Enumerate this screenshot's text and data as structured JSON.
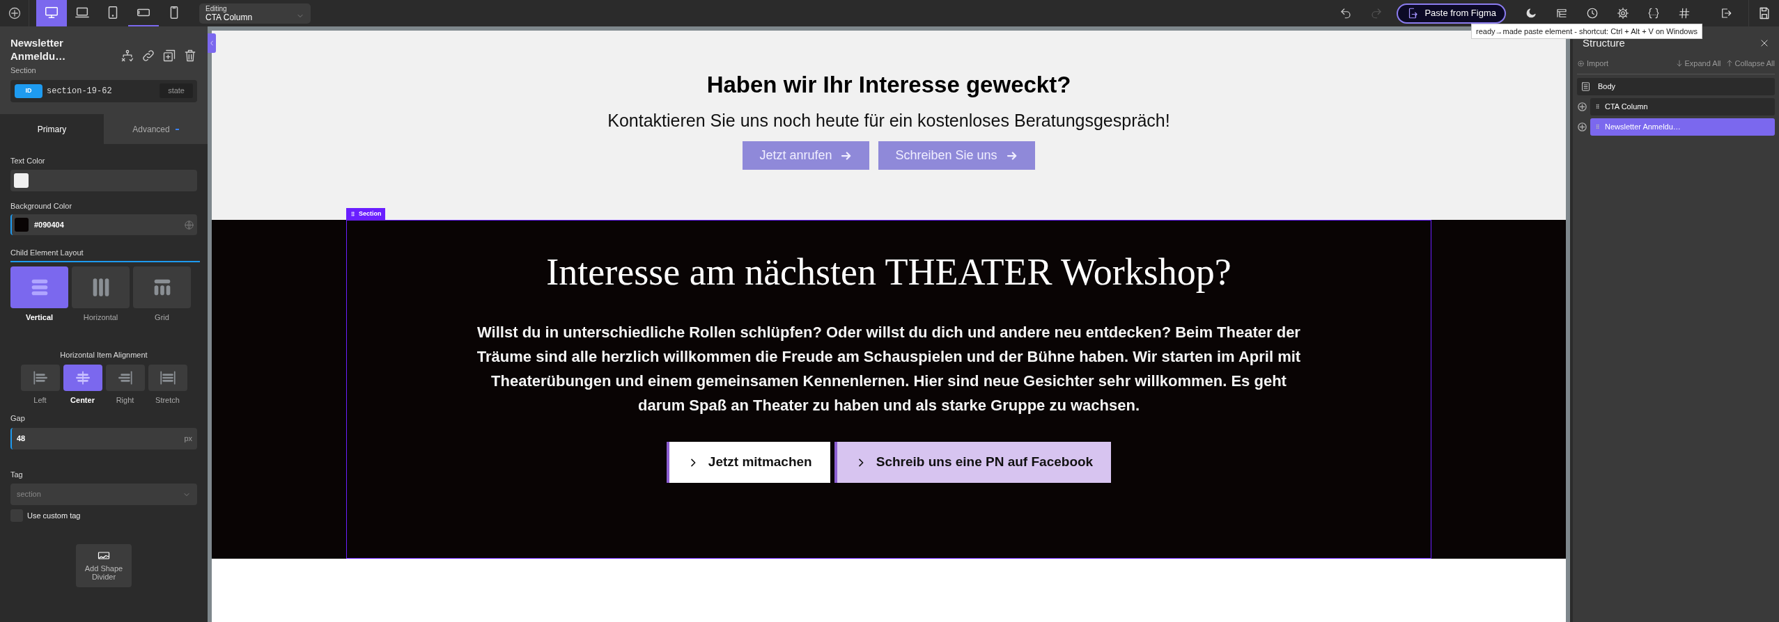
{
  "toolbar": {
    "devices": [
      {
        "kind": "desktop",
        "selected": true,
        "underlined": false
      },
      {
        "kind": "laptop",
        "selected": false,
        "underlined": false
      },
      {
        "kind": "tablet",
        "selected": false,
        "underlined": false
      },
      {
        "kind": "landscape",
        "selected": false,
        "underlined": true
      },
      {
        "kind": "phone",
        "selected": false,
        "underlined": false
      }
    ],
    "editing": {
      "label": "Editing",
      "value": "CTA Column"
    },
    "undo": {
      "disabled": false
    },
    "redo": {
      "disabled": true
    },
    "paste_button": "Paste from Figma",
    "tooltip": "ready→made paste element - shortcut: Ctrl + Alt + V on Windows"
  },
  "left_panel": {
    "element_name": "Newsletter Anmeldu…",
    "element_type": "Section",
    "id_badge": "ID",
    "id_value": "section-19-62",
    "state_button": "state",
    "tabs": [
      {
        "label": "Primary",
        "selected": true
      },
      {
        "label": "Advanced",
        "selected": false
      }
    ],
    "text_color": {
      "label": "Text Color"
    },
    "background_color": {
      "label": "Background Color",
      "value": "#090404"
    },
    "layout": {
      "label": "Child Element Layout",
      "options": [
        {
          "kind": "vertical",
          "label": "Vertical",
          "selected": true
        },
        {
          "kind": "horizontal",
          "label": "Horizontal",
          "selected": false
        },
        {
          "kind": "grid",
          "label": "Grid",
          "selected": false
        }
      ]
    },
    "alignment": {
      "label": "Horizontal Item Alignment",
      "options": [
        {
          "kind": "left",
          "label": "Left",
          "selected": false
        },
        {
          "kind": "center",
          "label": "Center",
          "selected": true
        },
        {
          "kind": "right",
          "label": "Right",
          "selected": false
        },
        {
          "kind": "stretch",
          "label": "Stretch",
          "selected": false
        }
      ]
    },
    "gap": {
      "label": "Gap",
      "value": "48",
      "unit": "px"
    },
    "tag": {
      "label": "Tag",
      "value": "section",
      "disabled": true
    },
    "custom_tag": {
      "label": "Use custom tag",
      "checked": false
    },
    "shape_divider_button": "Add Shape Divider"
  },
  "canvas": {
    "cta": {
      "heading": "Haben wir Ihr Interesse geweckt?",
      "subtext": "Kontaktieren Sie uns noch heute für ein kostenloses Beratungsgespräch!",
      "buttons": [
        "Jetzt anrufen",
        "Schreiben Sie uns"
      ]
    },
    "section_label": "Section",
    "section": {
      "heading": "Interesse am nächsten THEATER Workshop?",
      "paragraph": "Willst du in unterschiedliche Rollen schlüpfen? Oder willst du dich und andere neu entdecken? Beim Theater der Träume sind alle herzlich willkommen die Freude am Schauspielen und der Bühne haben. Wir starten im April mit Theaterübungen und einem gemeinsamen Kennenlernen. Hier sind neue Gesichter sehr willkommen. Es geht darum Spaß an Theater zu haben und als starke Gruppe zu wachsen.",
      "buttons": [
        {
          "kind": "primary",
          "label": "Jetzt mitmachen"
        },
        {
          "kind": "secondary",
          "label": "Schreib uns eine PN auf Facebook"
        }
      ]
    }
  },
  "structure": {
    "title": "Structure",
    "import": "Import",
    "expand_all": "Expand All",
    "collapse_all": "Collapse All",
    "tree": [
      {
        "label": "Body",
        "selected": false,
        "children": [
          {
            "label": "CTA Column",
            "selected": false
          },
          {
            "label": "Newsletter Anmeldu…",
            "selected": true
          }
        ]
      }
    ]
  }
}
